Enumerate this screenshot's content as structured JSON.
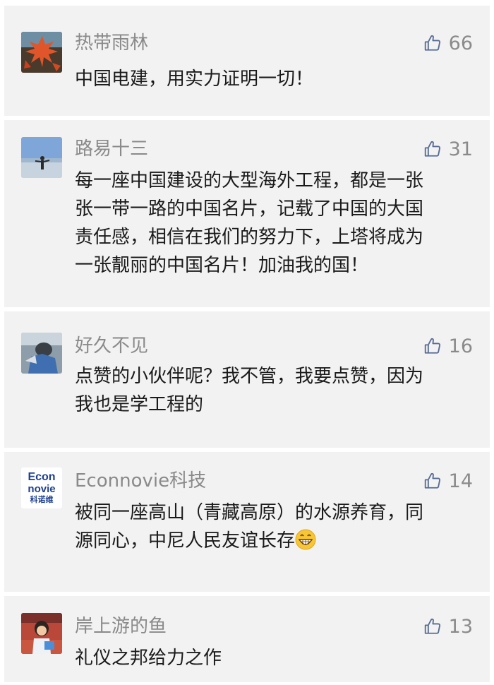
{
  "colors": {
    "card_background": "#f2f2f2",
    "page_background": "#ffffff",
    "name_text": "#8a8a8a",
    "comment_text": "#1a1a1a",
    "like_icon": "#576b95"
  },
  "comments": [
    {
      "avatar": "red-maple-leaf-avatar",
      "name": "热带雨林",
      "likes": "66",
      "lines": [
        "中国电建，用实力证明一切！"
      ]
    },
    {
      "avatar": "person-by-sea-avatar",
      "name": "路易十三",
      "likes": "31",
      "lines": [
        "每一座中国建设的大型海外工程，都是一张",
        "张一带一路的中国名片，记载了中国的大国",
        "责任感，相信在我们的努力下，上塔将成为",
        "一张靓丽的中国名片！加油我的国！"
      ]
    },
    {
      "avatar": "person-photo-avatar",
      "name": "好久不见",
      "likes": "16",
      "lines": [
        "点赞的小伙伴呢？我不管，我要点赞，因为",
        "我也是学工程的"
      ]
    },
    {
      "avatar": {
        "icon": "econnovie-logo-avatar",
        "logo_top": "Econ",
        "logo_middle": "novie",
        "logo_bottom": "科诺维"
      },
      "name": "Econnovie科技",
      "likes": "14",
      "lines": [
        "被同一座高山（青藏高原）的水源养育，同",
        "源同心，中尼人民友谊长存"
      ],
      "emoji": "grinning-face-emoji"
    },
    {
      "avatar": "child-photo-avatar",
      "name": "岸上游的鱼",
      "likes": "13",
      "lines": [
        "礼仪之邦给力之作"
      ]
    }
  ]
}
